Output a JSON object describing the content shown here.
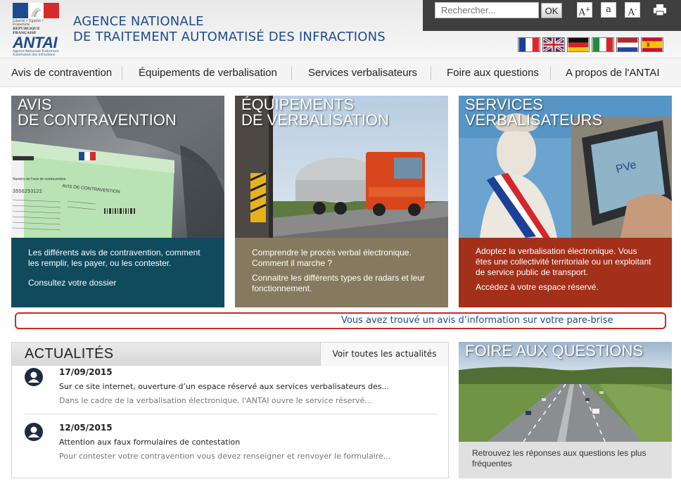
{
  "header": {
    "logo": {
      "motto": "Liberté • Égalité • Fraternité",
      "republic": "RÉPUBLIQUE FRANÇAISE",
      "brand": "ANTAI",
      "brand_sub": "Agence Nationale Traitement Automatisé des Infractions"
    },
    "agency_line1": "AGENCE NATIONALE",
    "agency_line2": "DE TRAITEMENT AUTOMATISÉ DES INFRACTIONS",
    "search_placeholder": "Rechercher...",
    "ok_label": "OK",
    "font_increase": "A+",
    "font_reset": "a",
    "font_decrease": "A-",
    "print_icon": "print-icon",
    "languages": [
      "fr",
      "en",
      "de",
      "it",
      "nl",
      "es"
    ]
  },
  "nav": {
    "items": [
      "Avis de contravention",
      "Équipements de verbalisation",
      "Services verbalisateurs",
      "Foire aux questions",
      "A propos de l'ANTAI"
    ]
  },
  "cards": [
    {
      "title1": "AVIS",
      "title2": "DE CONTRAVENTION",
      "text1": "Les différents avis de contravention, comment les remplir, les payer, ou les contester.",
      "text2": "Consultez votre dossier",
      "color": "#0f4a5d"
    },
    {
      "title1": "ÉQUIPEMENTS",
      "title2": "DE VERBALISATION",
      "text1": "Comprendre le procès verbal électronique. Comment il marche ?",
      "text2": "Connaitre les différents types de radars et leur fonctionnement.",
      "color": "#857a5f"
    },
    {
      "title1": "SERVICES",
      "title2": "VERBALISATEURS",
      "text1": "Adoptez la verbalisation électronique. Vous êtes une collectivité territoriale ou un exploitant de service public de transport.",
      "text2": "Accédez à votre espace réservé.",
      "color": "#a3301a"
    }
  ],
  "card_images": {
    "avis": {
      "doc_title": "AVIS DE CONTRAVENTION",
      "doc_label": "Numéro de l'avis de contravention",
      "doc_number": "3556253121"
    },
    "services": {
      "device_label": "PVe"
    }
  },
  "banner": {
    "text": "Vous avez trouvé un avis d’information sur votre pare-brise"
  },
  "news": {
    "title": "ACTUALITÉS",
    "all_label": "Voir toutes les actualités",
    "items": [
      {
        "date": "17/09/2015",
        "title": "Sur ce site internet, ouverture d’un espace réservé aux services verbalisateurs des...",
        "summary": "Dans le cadre de la verbalisation électronique, l'ANTAI ouvre le service réservé..."
      },
      {
        "date": "12/05/2015",
        "title": "Attention aux faux formulaires de contestation",
        "summary": "Pour contester votre contravention vous devez renseigner et renvoyer le formulaire..."
      }
    ]
  },
  "faq": {
    "title": "FOIRE AUX QUESTIONS",
    "text": "Retrouvez les réponses aux questions les plus fréquentes"
  }
}
